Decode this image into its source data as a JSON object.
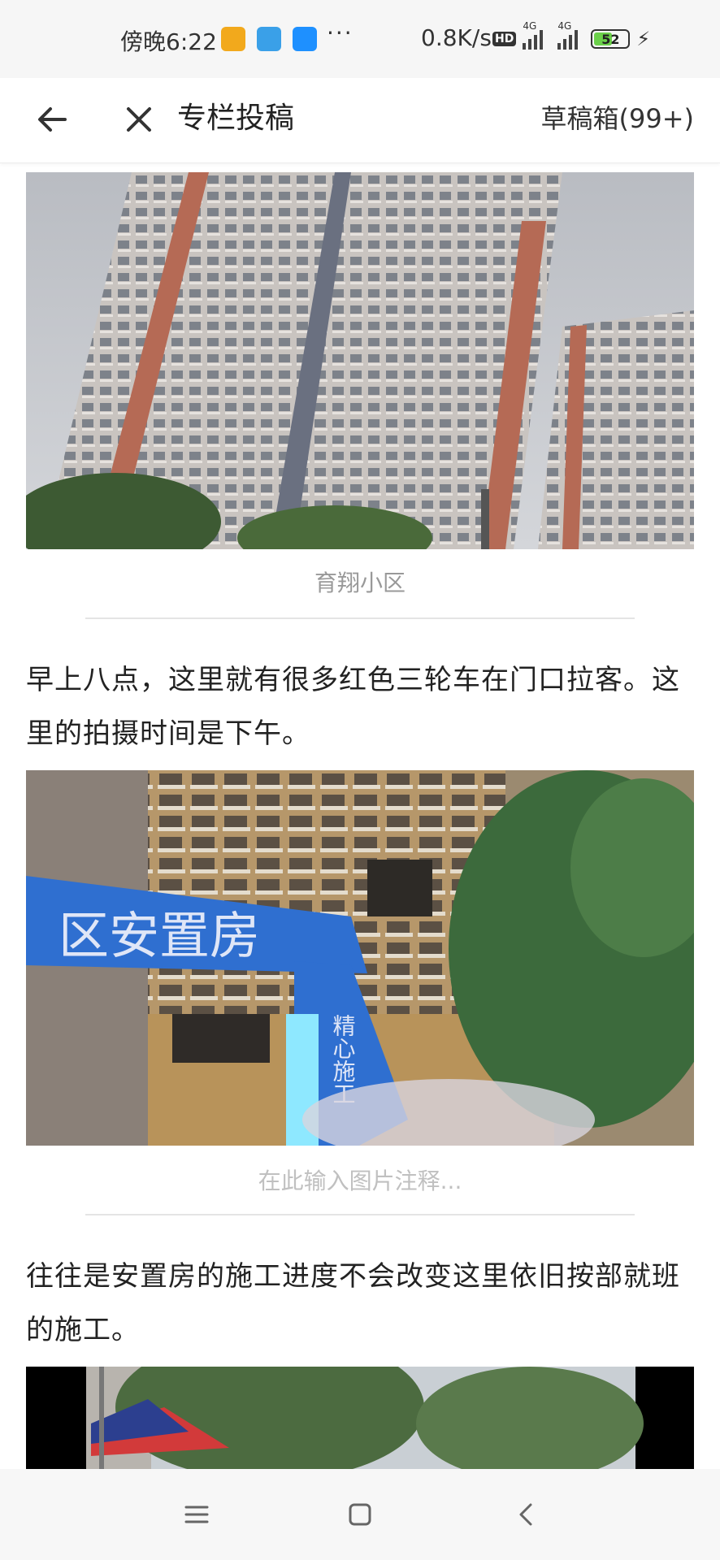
{
  "status_bar": {
    "time": "傍晚6:22",
    "more": "···",
    "net_speed": "0.8K/s",
    "hd": "HD",
    "signal1_tag": "4G",
    "signal2_tag": "4G",
    "battery": "52",
    "icons": [
      "notification-app-icon",
      "paper-plane-icon",
      "cloud-icon",
      "charging-bolt-icon"
    ]
  },
  "header": {
    "title": "专栏投稿",
    "drafts": "草稿箱(99+)"
  },
  "article": {
    "photo1_caption": "育翔小区",
    "paragraph1": "早上八点，这里就有很多红色三轮车在门口拉客。这里的拍摄时间是下午。",
    "photo2_caption_placeholder": "在此输入图片注释...",
    "paragraph2": "往往是安置房的施工进度不会改变这里依旧按部就班的施工。",
    "sign_text": "区安置房",
    "sign_side_text": "精心施工"
  },
  "colors": {
    "accent_battery": "#6bd04a",
    "sign_blue": "#2f6fd0"
  }
}
